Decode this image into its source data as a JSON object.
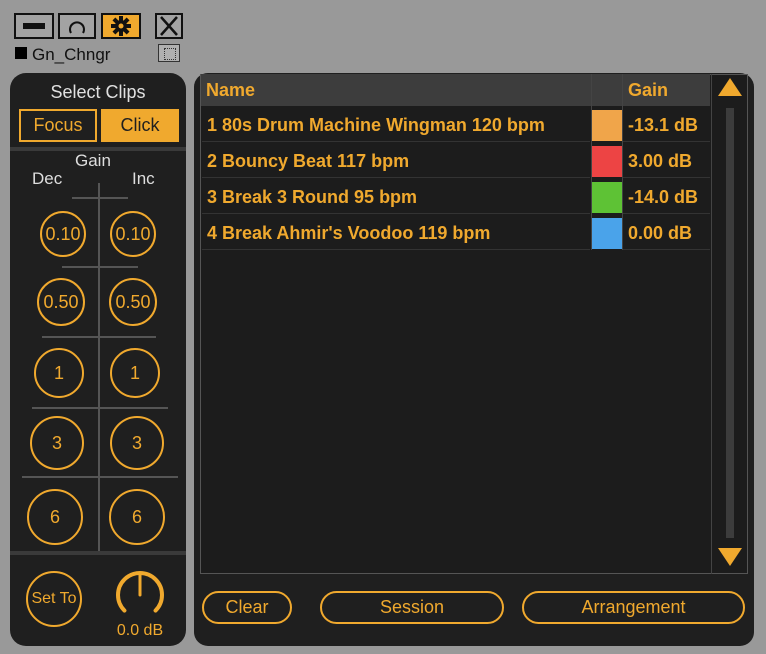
{
  "device": {
    "name": "Gn_Chngr",
    "toolbar": [
      "minimize-icon",
      "refresh-icon",
      "gear-icon",
      "close-icon"
    ]
  },
  "left": {
    "title": "Select Clips",
    "focus_label": "Focus",
    "click_label": "Click",
    "gain_label": "Gain",
    "dec_label": "Dec",
    "inc_label": "Inc",
    "dec_buttons": [
      "0.10",
      "0.50",
      "1",
      "3",
      "6"
    ],
    "inc_buttons": [
      "0.10",
      "0.50",
      "1",
      "3",
      "6"
    ],
    "set_to_label": "Set To",
    "dial_value": "0.0 dB",
    "dial_level": 0.5
  },
  "table": {
    "headers": {
      "name": "Name",
      "gain": "Gain"
    },
    "rows": [
      {
        "name": "1 80s Drum Machine Wingman 120 bpm",
        "color": "#f0a54a",
        "gain": "-13.1 dB"
      },
      {
        "name": "2 Bouncy Beat 117 bpm",
        "color": "#ed4444",
        "gain": "3.00 dB"
      },
      {
        "name": "3 Break 3 Round 95 bpm",
        "color": "#5ec235",
        "gain": "-14.0 dB"
      },
      {
        "name": "4 Break Ahmir's Voodoo 119 bpm",
        "color": "#4aa3ea",
        "gain": "0.00 dB"
      }
    ]
  },
  "buttons": {
    "clear": "Clear",
    "session": "Session",
    "arrangement": "Arrangement"
  },
  "colors": {
    "accent": "#f0a92e",
    "panel": "#1f1f1f",
    "frame": "#999999"
  }
}
